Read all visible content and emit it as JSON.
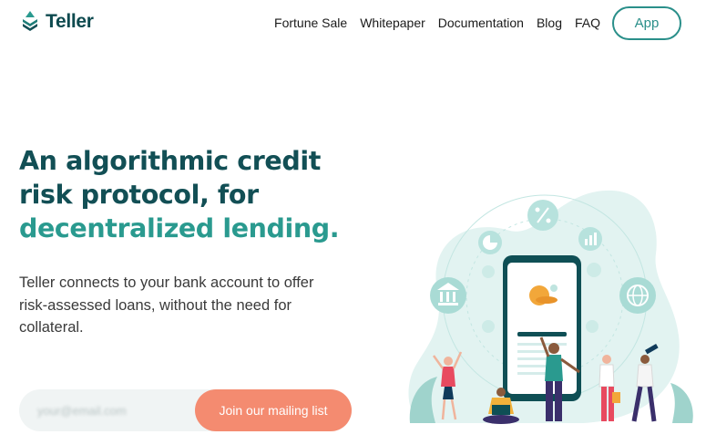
{
  "header": {
    "brand_name": "Teller",
    "nav": [
      {
        "label": "Fortune Sale"
      },
      {
        "label": "Whitepaper"
      },
      {
        "label": "Documentation"
      },
      {
        "label": "Blog"
      },
      {
        "label": "FAQ"
      }
    ],
    "app_button": "App"
  },
  "hero": {
    "title_line1": "An algorithmic credit",
    "title_line2": "risk protocol, for",
    "title_accent": "decentralized lending.",
    "subtitle_line1": "Teller connects to your bank account to offer",
    "subtitle_line2": "risk-assessed loans, without the need for",
    "subtitle_line3": "collateral."
  },
  "signup": {
    "email_placeholder": "your@email.com",
    "join_button": "Join our mailing list"
  },
  "colors": {
    "brand_dark": "#124f55",
    "brand_teal": "#2a9a8f",
    "cta_coral": "#f48b70"
  }
}
